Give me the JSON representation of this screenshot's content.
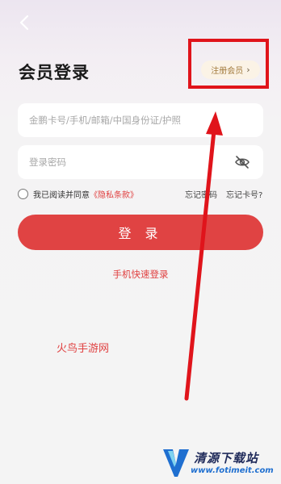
{
  "header": {
    "title": "会员登录",
    "register_label": "注册会员",
    "register_chevron": "›"
  },
  "form": {
    "account_placeholder": "金鹏卡号/手机/邮箱/中国身份证/护照",
    "account_value": "",
    "password_placeholder": "登录密码",
    "password_value": "",
    "agree_prefix": "我已阅读并同意",
    "privacy_label": "《隐私条款》",
    "agree_checked": false,
    "forgot_password": "忘记密码",
    "forgot_card": "忘记卡号?",
    "login_label": "登 录",
    "quick_login": "手机快速登录"
  },
  "overlay": {
    "watermark": "火鸟手游网",
    "logo_title": "清源下载站",
    "logo_url": "www.fotimeit.com"
  },
  "colors": {
    "accent": "#e04343",
    "highlight": "#e0141b",
    "register_text": "#a27a3c"
  },
  "icons": {
    "back": "back-chevron-icon",
    "eye": "eye-hidden-icon"
  }
}
